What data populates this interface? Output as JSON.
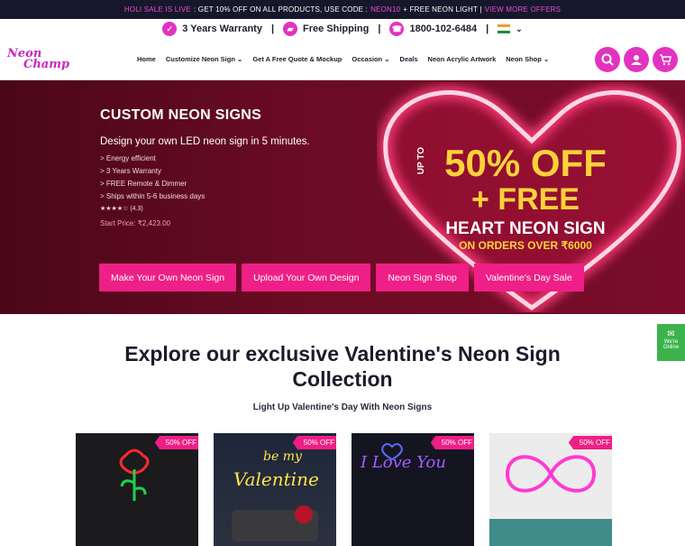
{
  "topbar": {
    "part1": "HOLI SALE IS LIVE",
    "part2": ": GET 10% OFF ON ALL PRODUCTS, USE CODE :",
    "code": "NEON10",
    "part3": "+ FREE NEON LIGHT |",
    "link": "VIEW MORE OFFERS"
  },
  "infobar": {
    "warranty": "3 Years Warranty",
    "shipping": "Free Shipping",
    "phone": "1800-102-6484",
    "sep": "|"
  },
  "logo": {
    "line1": "Neon",
    "line2": "Champ"
  },
  "menu": [
    "Home",
    "Customize Neon Sign",
    "Get A Free Quote & Mockup",
    "Occasion",
    "Deals",
    "Neon Acrylic Artwork",
    "Neon Shop"
  ],
  "hero": {
    "title": "CUSTOM NEON SIGNS",
    "subtitle": "Design your own LED neon sign in 5 minutes.",
    "features": [
      "> Energy efficient",
      "> 3 Years Warranty",
      "> FREE Remote & Dimmer",
      "> Ships within 5-6 business days"
    ],
    "rating": "(4.3)",
    "start_price": "Start Price: ₹2,423.00",
    "offer": {
      "upto": "UP TO",
      "big": "50% OFF",
      "free": "+ FREE",
      "heart_text": "HEART NEON SIGN",
      "orders": "ON ORDERS OVER ₹6000"
    },
    "ctas": [
      "Make Your Own Neon Sign",
      "Upload Your Own Design",
      "Neon Sign Shop",
      "Valentine's Day Sale"
    ]
  },
  "chat": {
    "line1": "We're",
    "line2": "Online"
  },
  "section": {
    "title_line1": "Explore our exclusive Valentine's Neon Sign",
    "title_line2": "Collection",
    "subtitle": "Light Up Valentine's Day With Neon Signs"
  },
  "cards": [
    {
      "badge": "50% OFF"
    },
    {
      "badge": "50% OFF"
    },
    {
      "badge": "50% OFF"
    },
    {
      "badge": "50% OFF"
    }
  ],
  "colors": {
    "accent": "#ee1f86",
    "brand": "#e233c0",
    "hero_bg": "#6b0b24",
    "offer": "#ffd23a"
  }
}
